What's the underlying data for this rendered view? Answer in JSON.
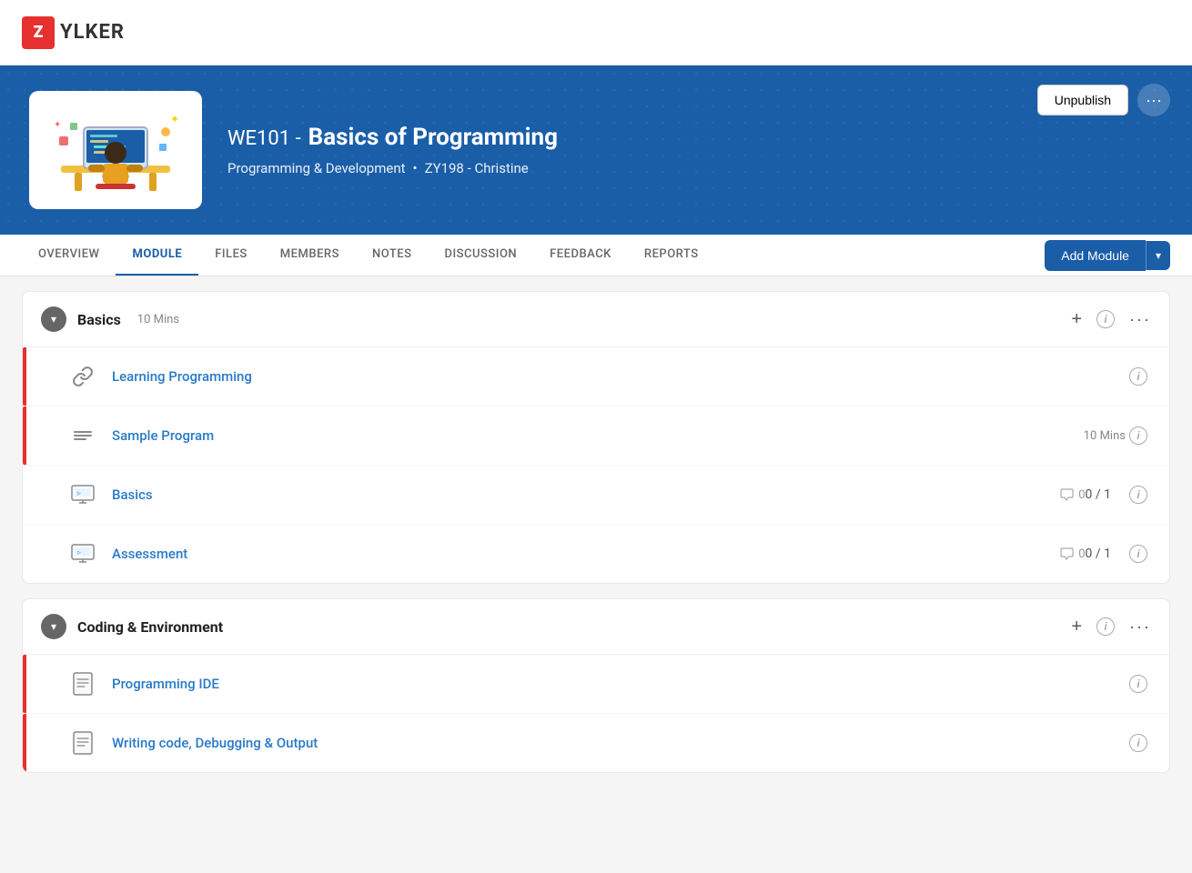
{
  "logo": {
    "icon_text": "Z",
    "text": "YLKER"
  },
  "banner": {
    "course_code": "WE101  -",
    "course_title": "Basics of Programming",
    "category": "Programming & Development",
    "separator": "•",
    "instructor": "ZY198 - Christine",
    "unpublish_label": "Unpublish",
    "more_icon": "···"
  },
  "tabs": [
    {
      "id": "overview",
      "label": "OVERVIEW",
      "active": false
    },
    {
      "id": "module",
      "label": "MODULE",
      "active": true
    },
    {
      "id": "files",
      "label": "FILES",
      "active": false
    },
    {
      "id": "members",
      "label": "MEMBERS",
      "active": false
    },
    {
      "id": "notes",
      "label": "NOTES",
      "active": false
    },
    {
      "id": "discussion",
      "label": "DISCUSSION",
      "active": false
    },
    {
      "id": "feedback",
      "label": "FEEDBACK",
      "active": false
    },
    {
      "id": "reports",
      "label": "REPORTS",
      "active": false
    }
  ],
  "add_module_label": "Add Module",
  "modules": [
    {
      "id": "basics",
      "name": "Basics",
      "duration": "10 Mins",
      "items": [
        {
          "id": "learning-programming",
          "icon": "link",
          "title": "Learning Programming",
          "duration": null,
          "comment_count": null,
          "score": null,
          "has_accent": true
        },
        {
          "id": "sample-program",
          "icon": "lines",
          "title": "Sample Program",
          "duration": "10 Mins",
          "comment_count": null,
          "score": null,
          "has_accent": true
        },
        {
          "id": "basics-lesson",
          "icon": "monitor",
          "title": "Basics",
          "duration": null,
          "comment_count": "0",
          "score": "0 / 1",
          "has_accent": false
        },
        {
          "id": "assessment",
          "icon": "monitor",
          "title": "Assessment",
          "duration": null,
          "comment_count": "0",
          "score": "0 / 1",
          "has_accent": false
        }
      ]
    },
    {
      "id": "coding-environment",
      "name": "Coding & Environment",
      "duration": null,
      "items": [
        {
          "id": "programming-ide",
          "icon": "doc-lines",
          "title": "Programming IDE",
          "duration": null,
          "comment_count": null,
          "score": null,
          "has_accent": true
        },
        {
          "id": "writing-code",
          "icon": "doc-lines",
          "title": "Writing code, Debugging & Output",
          "duration": null,
          "comment_count": null,
          "score": null,
          "has_accent": true
        }
      ]
    }
  ]
}
